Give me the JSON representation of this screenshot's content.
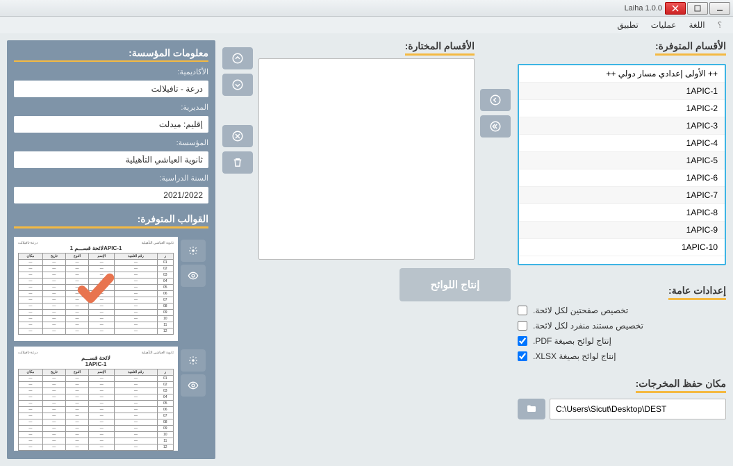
{
  "window": {
    "title": "Laiha 1.0.0"
  },
  "menu": {
    "help": "؟",
    "lang": "اللغة",
    "ops": "عمليات",
    "app": "تطبيق"
  },
  "sections": {
    "available": "الأقسام المتوفرة:",
    "selected": "الأقسام المختارة:",
    "settings": "إعدادات عامة:",
    "output": "مكان حفظ المخرجات:",
    "institution": "معلومات المؤسسة:",
    "templates": "القوالب المتوفرة:"
  },
  "available_items": [
    "++ الأولى إعدادي مسار دولي ++",
    "1APIC-1",
    "1APIC-2",
    "1APIC-3",
    "1APIC-4",
    "1APIC-5",
    "1APIC-6",
    "1APIC-7",
    "1APIC-8",
    "1APIC-9",
    "1APIC-10"
  ],
  "settings": {
    "two_pages": {
      "label": "تخصيص صفحتين لكل لائحة.",
      "checked": false
    },
    "doc_per_list": {
      "label": "تخصيص مستند منفرد لكل لائحة.",
      "checked": false
    },
    "pdf": {
      "label": "إنتاج لوائح بصيغة PDF.",
      "checked": true
    },
    "xlsx": {
      "label": "إنتاج لوائح بصيغة XLSX.",
      "checked": true
    }
  },
  "output_path": "C:\\Users\\Sicut\\Desktop\\DEST",
  "institution": {
    "academy_label": "الأكاديمية:",
    "academy": "درعة - تافيلالت",
    "direction_label": "المديرية:",
    "direction": "إقليم: ميدلت",
    "school_label": "المؤسسة:",
    "school": "ثانوية العياشي التأهيلية",
    "year_label": "السنة الدراسية:",
    "year": "2021/2022"
  },
  "templates": [
    {
      "title": "لائحة قســـم 1APIC-1",
      "selected": true
    },
    {
      "title": "لائحة قســـم",
      "subtitle": "1APIC-1",
      "selected": false
    }
  ],
  "generate": "إنتاج اللوائح"
}
